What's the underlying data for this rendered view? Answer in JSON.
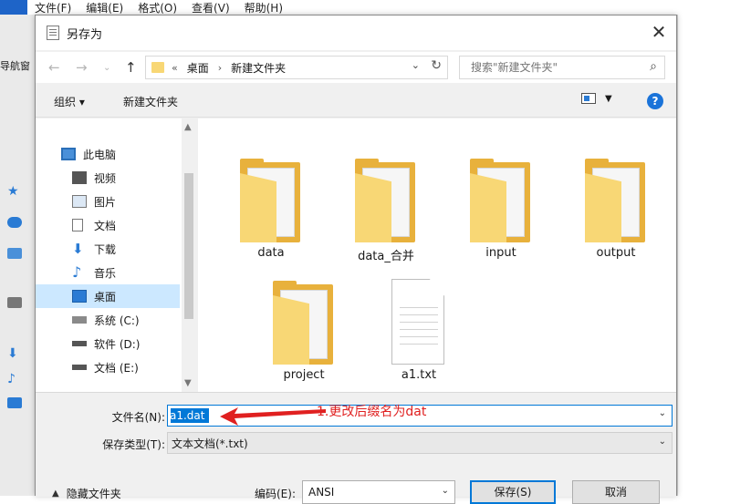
{
  "background_window": {
    "menu": [
      "文件(F)",
      "编辑(E)",
      "格式(O)",
      "查看(V)",
      "帮助(H)"
    ],
    "left_fragment": "导航窗"
  },
  "dialog": {
    "title": "另存为",
    "close_glyph": "✕"
  },
  "address": {
    "overflow": "«",
    "crumbs": [
      "桌面",
      "新建文件夹"
    ],
    "search_placeholder": "搜索\"新建文件夹\""
  },
  "commandbar": {
    "organize_label": "组织 ▾",
    "new_folder_label": "新建文件夹",
    "help_glyph": "?"
  },
  "nav": {
    "items": [
      {
        "label": "此电脑",
        "icon": "computer-icon"
      },
      {
        "label": "视频",
        "icon": "video-icon"
      },
      {
        "label": "图片",
        "icon": "pictures-icon"
      },
      {
        "label": "文档",
        "icon": "documents-icon"
      },
      {
        "label": "下载",
        "icon": "download-icon"
      },
      {
        "label": "音乐",
        "icon": "music-icon"
      },
      {
        "label": "桌面",
        "icon": "desktop-icon"
      },
      {
        "label": "系统 (C:)",
        "icon": "drive-icon"
      },
      {
        "label": "软件 (D:)",
        "icon": "drive-icon"
      },
      {
        "label": "文档 (E:)",
        "icon": "drive-icon"
      }
    ],
    "selected": "桌面"
  },
  "files": [
    {
      "name": "data",
      "type": "folder"
    },
    {
      "name": "data_合并",
      "type": "folder"
    },
    {
      "name": "input",
      "type": "folder"
    },
    {
      "name": "output",
      "type": "folder"
    },
    {
      "name": "project",
      "type": "folder"
    },
    {
      "name": "a1.txt",
      "type": "text-file"
    }
  ],
  "form": {
    "filename_label": "文件名(N):",
    "filename_value": "a1.dat",
    "filetype_label": "保存类型(T):",
    "filetype_value": "文本文档(*.txt)",
    "annotation": "1.更改后缀名为dat",
    "annotation_color": "#e02020",
    "hide_folders_label": "隐藏文件夹",
    "encoding_label": "编码(E):",
    "encoding_value": "ANSI",
    "save_label": "保存(S)",
    "cancel_label": "取消"
  },
  "colors": {
    "accent": "#0078d7",
    "folder": "#f8d775",
    "selection": "#cce8ff"
  }
}
